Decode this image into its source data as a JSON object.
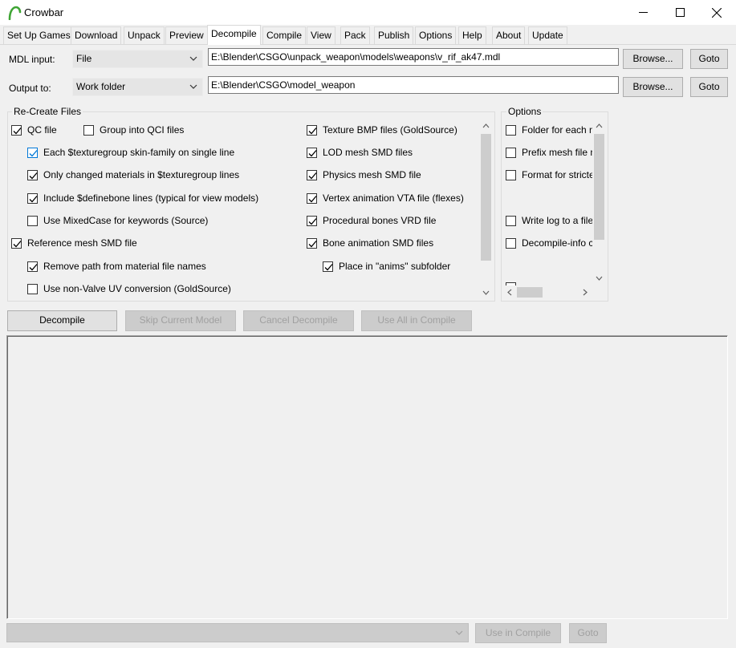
{
  "window": {
    "title": "Crowbar",
    "controls": {
      "minimize": "minimize-icon",
      "maximize": "maximize-icon",
      "close": "close-icon"
    }
  },
  "tabs": [
    "Set Up Games",
    "Download",
    "Unpack",
    "Preview",
    "Decompile",
    "Compile",
    "View",
    "Pack",
    "Publish",
    "Options",
    "Help",
    "About",
    "Update"
  ],
  "active_tab": "Decompile",
  "mdl_input": {
    "label": "MDL input:",
    "mode": "File",
    "path": "E:\\Blender\\CSGO\\unpack_weapon\\models\\weapons\\v_rif_ak47.mdl",
    "browse": "Browse...",
    "goto": "Goto"
  },
  "output_to": {
    "label": "Output to:",
    "mode": "Work folder",
    "path": "E:\\Blender\\CSGO\\model_weapon",
    "browse": "Browse...",
    "goto": "Goto"
  },
  "recreate": {
    "title": "Re-Create Files",
    "items": [
      {
        "label": "QC file",
        "checked": true
      },
      {
        "label": "Group into QCI files",
        "checked": false
      },
      {
        "label": "Each $texturegroup skin-family on single line",
        "checked": true
      },
      {
        "label": "Only changed materials in $texturegroup lines",
        "checked": true
      },
      {
        "label": "Include $definebone lines (typical for view models)",
        "checked": true
      },
      {
        "label": "Use MixedCase for keywords (Source)",
        "checked": false
      },
      {
        "label": "Reference mesh SMD file",
        "checked": true
      },
      {
        "label": "Remove path from material file names",
        "checked": true
      },
      {
        "label": "Use non-Valve UV conversion (GoldSource)",
        "checked": false
      },
      {
        "label": "Texture BMP files (GoldSource)",
        "checked": true
      },
      {
        "label": "LOD mesh SMD files",
        "checked": true
      },
      {
        "label": "Physics mesh SMD file",
        "checked": true
      },
      {
        "label": "Vertex animation VTA file (flexes)",
        "checked": true
      },
      {
        "label": "Procedural bones VRD file",
        "checked": true
      },
      {
        "label": "Bone animation SMD files",
        "checked": true
      },
      {
        "label": "Place in \"anims\" subfolder",
        "checked": true
      }
    ]
  },
  "options": {
    "title": "Options",
    "items": [
      {
        "label": "Folder for each m",
        "checked": false
      },
      {
        "label": "Prefix mesh file n",
        "checked": false
      },
      {
        "label": "Format for stricte",
        "checked": false
      },
      {
        "label": "Write log to a file",
        "checked": false
      },
      {
        "label": "Decompile-info c",
        "checked": false
      }
    ]
  },
  "actions": {
    "decompile": "Decompile",
    "skip": "Skip Current Model",
    "cancel": "Cancel Decompile",
    "use_all": "Use All in Compile"
  },
  "bottom": {
    "combo_value": "",
    "use_in_compile": "Use in Compile",
    "goto": "Goto"
  }
}
